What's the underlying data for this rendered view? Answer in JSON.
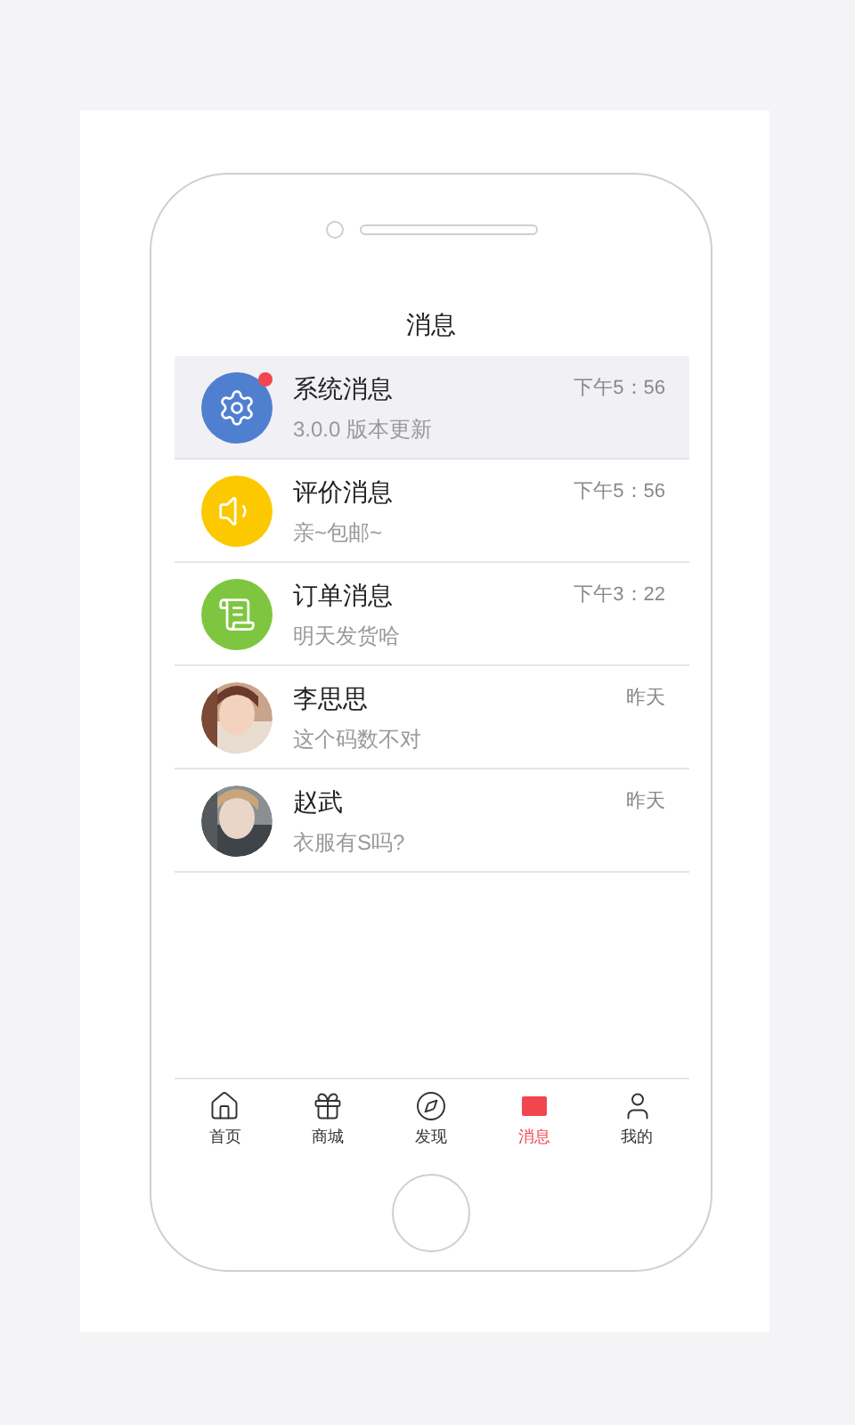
{
  "screen": {
    "title": "消息"
  },
  "messages": [
    {
      "kind": "system",
      "name": "系统消息",
      "preview": "3.0.0 版本更新",
      "time": "下午5：56",
      "selected": true,
      "unread": true,
      "color": "#4f80d0"
    },
    {
      "kind": "review",
      "name": "评价消息",
      "preview": "亲~包邮~",
      "time": "下午5：56",
      "selected": false,
      "unread": false,
      "color": "#fcc900"
    },
    {
      "kind": "order",
      "name": "订单消息",
      "preview": "明天发货哈",
      "time": "下午3：22",
      "selected": false,
      "unread": false,
      "color": "#7ec63f"
    },
    {
      "name": "李思思",
      "preview": "这个码数不对",
      "time": "昨天",
      "selected": false,
      "unread": false
    },
    {
      "kind": "photo2",
      "name": "赵武",
      "preview": "衣服有S吗?",
      "time": "昨天",
      "selected": false,
      "unread": false
    }
  ],
  "tabs": [
    {
      "kind": "home",
      "label": "首页",
      "selected": false
    },
    {
      "kind": "shop",
      "label": "商城",
      "selected": false
    },
    {
      "kind": "discover",
      "label": "发现",
      "selected": false
    },
    {
      "kind": "messages",
      "label": "消息",
      "selected": true
    },
    {
      "kind": "me",
      "label": "我的",
      "selected": false
    }
  ]
}
